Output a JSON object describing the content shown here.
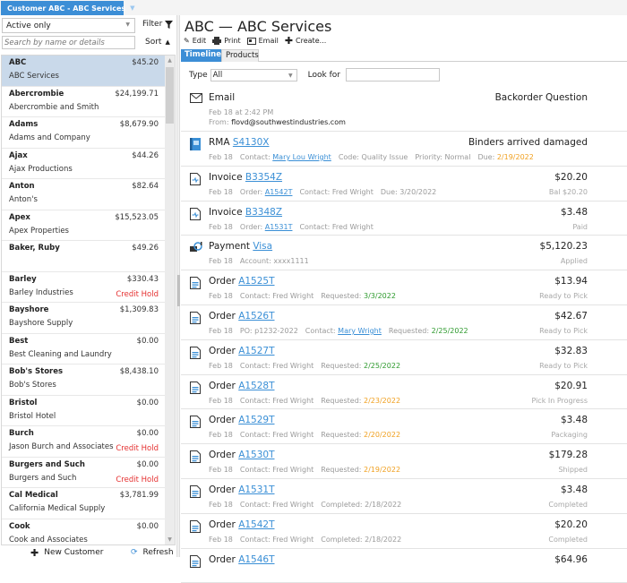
{
  "window_tab": {
    "title": "Customer ABC - ABC Services"
  },
  "left": {
    "filter_value": "Active only",
    "filter_label": "Filter",
    "search_placeholder": "Search by name or details",
    "sort_label": "Sort",
    "customers": [
      {
        "name": "ABC",
        "full": "ABC Services",
        "balance": "$45.20",
        "hold": "",
        "selected": true
      },
      {
        "name": "Abercrombie",
        "full": "Abercrombie and Smith",
        "balance": "$24,199.71",
        "hold": ""
      },
      {
        "name": "Adams",
        "full": "Adams and Company",
        "balance": "$8,679.90",
        "hold": ""
      },
      {
        "name": "Ajax",
        "full": "Ajax Productions",
        "balance": "$44.26",
        "hold": ""
      },
      {
        "name": "Anton",
        "full": "Anton's",
        "balance": "$82.64",
        "hold": ""
      },
      {
        "name": "Apex",
        "full": "Apex Properties",
        "balance": "$15,523.05",
        "hold": ""
      },
      {
        "name": "Baker, Ruby",
        "full": "",
        "balance": "$49.26",
        "hold": ""
      },
      {
        "name": "Barley",
        "full": "Barley Industries",
        "balance": "$330.43",
        "hold": "Credit Hold"
      },
      {
        "name": "Bayshore",
        "full": "Bayshore Supply",
        "balance": "$1,309.83",
        "hold": ""
      },
      {
        "name": "Best",
        "full": "Best Cleaning and Laundry",
        "balance": "$0.00",
        "hold": ""
      },
      {
        "name": "Bob's Stores",
        "full": "Bob's Stores",
        "balance": "$8,438.10",
        "hold": ""
      },
      {
        "name": "Bristol",
        "full": "Bristol Hotel",
        "balance": "$0.00",
        "hold": ""
      },
      {
        "name": "Burch",
        "full": "Jason Burch and Associates",
        "balance": "$0.00",
        "hold": "Credit Hold"
      },
      {
        "name": "Burgers and Such",
        "full": "Burgers and Such",
        "balance": "$0.00",
        "hold": "Credit Hold"
      },
      {
        "name": "Cal Medical",
        "full": "California Medical Supply",
        "balance": "$3,781.99",
        "hold": ""
      },
      {
        "name": "Cook",
        "full": "Cook and Associates",
        "balance": "$0.00",
        "hold": ""
      }
    ],
    "new_customer_label": "New Customer",
    "refresh_label": "Refresh"
  },
  "right": {
    "title": "ABC — ABC Services",
    "toolbar": {
      "edit": "Edit",
      "print": "Print",
      "email": "Email",
      "create": "Create..."
    },
    "tabs": [
      "Timeline",
      "Products"
    ],
    "type_label": "Type",
    "type_value": "All",
    "look_for_label": "Look for",
    "look_for_value": ""
  },
  "timeline": [
    {
      "kind": "email",
      "icon": "envelope-icon",
      "title": "Email",
      "date": "Feb 18 at 2:42 PM",
      "from_label": "From:",
      "from": "flovd@southwestindustries.com",
      "subject": "Backorder Question"
    },
    {
      "kind": "rma",
      "icon": "rma-book-icon",
      "title": "RMA",
      "link": "S4130X",
      "right": "Binders arrived damaged",
      "status": "",
      "parts": [
        {
          "t": "Feb 18"
        },
        {
          "t": "Contact: "
        },
        {
          "t": "Mary Lou Wright",
          "c": "link",
          "join": true
        },
        {
          "t": "Code: Quality Issue"
        },
        {
          "t": "Priority: Normal"
        },
        {
          "t": "Due: "
        },
        {
          "t": "2/19/2022",
          "c": "orange",
          "join": true
        }
      ]
    },
    {
      "kind": "invoice",
      "icon": "invoice-icon",
      "title": "Invoice",
      "link": "B3354Z",
      "right": "$20.20",
      "status": "Bal $20.20",
      "parts": [
        {
          "t": "Feb 18"
        },
        {
          "t": "Order: "
        },
        {
          "t": "A1542T",
          "c": "link",
          "join": true
        },
        {
          "t": "Contact: Fred Wright"
        },
        {
          "t": "Due: 3/20/2022"
        }
      ]
    },
    {
      "kind": "invoice",
      "icon": "invoice-icon",
      "title": "Invoice",
      "link": "B3348Z",
      "right": "$3.48",
      "status": "Paid",
      "parts": [
        {
          "t": "Feb 18"
        },
        {
          "t": "Order: "
        },
        {
          "t": "A1531T",
          "c": "link",
          "join": true
        },
        {
          "t": "Contact: Fred Wright"
        }
      ]
    },
    {
      "kind": "payment",
      "icon": "payment-icon",
      "title": "Payment",
      "link": "Visa",
      "right": "$5,120.23",
      "status": "Applied",
      "parts": [
        {
          "t": "Feb 18"
        },
        {
          "t": "Account: xxxx1111"
        }
      ]
    },
    {
      "kind": "order",
      "icon": "order-document-icon",
      "title": "Order",
      "link": "A1525T",
      "right": "$13.94",
      "status": "Ready to Pick",
      "parts": [
        {
          "t": "Feb 18"
        },
        {
          "t": "Contact: Fred Wright"
        },
        {
          "t": "Requested: "
        },
        {
          "t": "3/3/2022",
          "c": "green",
          "join": true
        }
      ]
    },
    {
      "kind": "order",
      "icon": "order-document-icon",
      "title": "Order",
      "link": "A1526T",
      "right": "$42.67",
      "status": "Ready to Pick",
      "parts": [
        {
          "t": "Feb 18"
        },
        {
          "t": "PO: p1232-2022"
        },
        {
          "t": "Contact: "
        },
        {
          "t": "Mary Wright",
          "c": "link",
          "join": true
        },
        {
          "t": "Requested: "
        },
        {
          "t": "2/25/2022",
          "c": "green",
          "join": true
        }
      ]
    },
    {
      "kind": "order",
      "icon": "order-document-icon",
      "title": "Order",
      "link": "A1527T",
      "right": "$32.83",
      "status": "Ready to Pick",
      "parts": [
        {
          "t": "Feb 18"
        },
        {
          "t": "Contact: Fred Wright"
        },
        {
          "t": "Requested: "
        },
        {
          "t": "2/25/2022",
          "c": "green",
          "join": true
        }
      ]
    },
    {
      "kind": "order",
      "icon": "order-document-icon",
      "title": "Order",
      "link": "A1528T",
      "right": "$20.91",
      "status": "Pick In Progress",
      "parts": [
        {
          "t": "Feb 18"
        },
        {
          "t": "Contact: Fred Wright"
        },
        {
          "t": "Requested: "
        },
        {
          "t": "2/23/2022",
          "c": "orange",
          "join": true
        }
      ]
    },
    {
      "kind": "order",
      "icon": "order-document-icon",
      "title": "Order",
      "link": "A1529T",
      "right": "$3.48",
      "status": "Packaging",
      "parts": [
        {
          "t": "Feb 18"
        },
        {
          "t": "Contact: Fred Wright"
        },
        {
          "t": "Requested: "
        },
        {
          "t": "2/20/2022",
          "c": "orange",
          "join": true
        }
      ]
    },
    {
      "kind": "order",
      "icon": "order-document-icon",
      "title": "Order",
      "link": "A1530T",
      "right": "$179.28",
      "status": "Shipped",
      "parts": [
        {
          "t": "Feb 18"
        },
        {
          "t": "Contact: Fred Wright"
        },
        {
          "t": "Requested: "
        },
        {
          "t": "2/19/2022",
          "c": "orange",
          "join": true
        }
      ]
    },
    {
      "kind": "order",
      "icon": "order-document-icon",
      "title": "Order",
      "link": "A1531T",
      "right": "$3.48",
      "status": "Completed",
      "parts": [
        {
          "t": "Feb 18"
        },
        {
          "t": "Contact: Fred Wright"
        },
        {
          "t": "Completed: 2/18/2022"
        }
      ]
    },
    {
      "kind": "order",
      "icon": "order-document-icon",
      "title": "Order",
      "link": "A1542T",
      "right": "$20.20",
      "status": "Completed",
      "parts": [
        {
          "t": "Feb 18"
        },
        {
          "t": "Contact: Fred Wright"
        },
        {
          "t": "Completed: 2/18/2022"
        }
      ]
    },
    {
      "kind": "order",
      "icon": "order-document-icon",
      "title": "Order",
      "link": "A1546T",
      "right": "$64.96",
      "status": "",
      "parts": []
    }
  ],
  "colors": {
    "accent": "#3c8ed6",
    "link": "#3a8fd6",
    "credit_hold": "#e53030",
    "green": "#2e9a2e",
    "orange": "#f0a020",
    "selected_row": "#c9d9ea"
  }
}
